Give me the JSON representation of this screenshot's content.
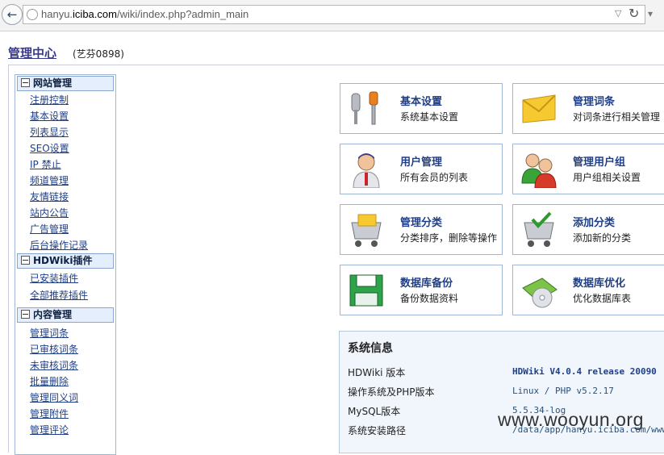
{
  "browser": {
    "url_prefix": "hanyu.",
    "url_domain": "iciba.com",
    "url_path": "/wiki/index.php?admin_main"
  },
  "header": {
    "title": "管理中心",
    "user": "(艺芬0898)"
  },
  "sidebar": {
    "sections": [
      {
        "title": "网站管理",
        "items": [
          "注册控制",
          "基本设置",
          "列表显示",
          "SEO设置",
          "IP 禁止",
          "频道管理",
          "友情链接",
          "站内公告",
          "广告管理",
          "后台操作记录"
        ]
      },
      {
        "title": "HDWiki插件",
        "items": [
          "已安装插件",
          "全部推荐插件"
        ]
      },
      {
        "title": "内容管理",
        "items": [
          "管理词条",
          "已审核词条",
          "未审核词条",
          "批量删除",
          "管理同义词",
          "管理附件",
          "管理评论"
        ]
      }
    ]
  },
  "tiles": [
    {
      "title": "基本设置",
      "desc": "系统基本设置",
      "icon": "tools-icon"
    },
    {
      "title": "管理词条",
      "desc": "对词条进行相关管理",
      "icon": "envelope-icon"
    },
    {
      "title": "用户管理",
      "desc": "所有会员的列表",
      "icon": "user-icon"
    },
    {
      "title": "管理用户组",
      "desc": "用户组相关设置",
      "icon": "user-group-icon"
    },
    {
      "title": "管理分类",
      "desc": "分类排序，删除等操作",
      "icon": "cart-folder-icon"
    },
    {
      "title": "添加分类",
      "desc": "添加新的分类",
      "icon": "cart-add-icon"
    },
    {
      "title": "数据库备份",
      "desc": "备份数据资料",
      "icon": "floppy-icon"
    },
    {
      "title": "数据库优化",
      "desc": "优化数据库表",
      "icon": "disc-icon"
    }
  ],
  "system_info": {
    "title": "系统信息",
    "rows": [
      {
        "label": "HDWiki 版本",
        "value": "HDWiki V4.0.4 release 20090"
      },
      {
        "label": "操作系统及PHP版本",
        "value": "Linux / PHP v5.2.17"
      },
      {
        "label": "MySQL版本",
        "value": "5.5.34-log"
      },
      {
        "label": "系统安装路径",
        "value": "/data/app/hanyu.iciba.com/wwwroo"
      }
    ]
  },
  "watermark": "www.wooyun.org",
  "colors": {
    "link": "#1f3f86",
    "panel_bg": "#f1f6fd",
    "tile_border": "#9fb6d6",
    "section_bg": "#e4eefc"
  }
}
